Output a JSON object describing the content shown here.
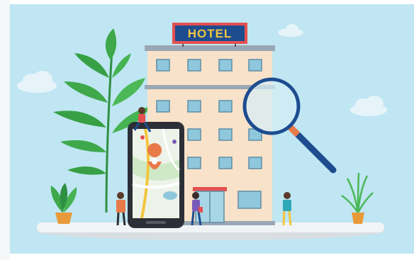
{
  "sign": {
    "text": "HOTEL"
  },
  "colors": {
    "sky": "#bfe6f2",
    "building": "#f8e2c9",
    "sign_bg": "#1d4c8f",
    "sign_text": "#f3c53d",
    "phone": "#2c2f36",
    "map_pin": "#e87a4a",
    "leaf": "#3ea84b",
    "platform": "#f1f4f6"
  },
  "icons": [
    "map-pin-icon",
    "magnifier-icon",
    "cloud-icon",
    "plant-icon"
  ]
}
